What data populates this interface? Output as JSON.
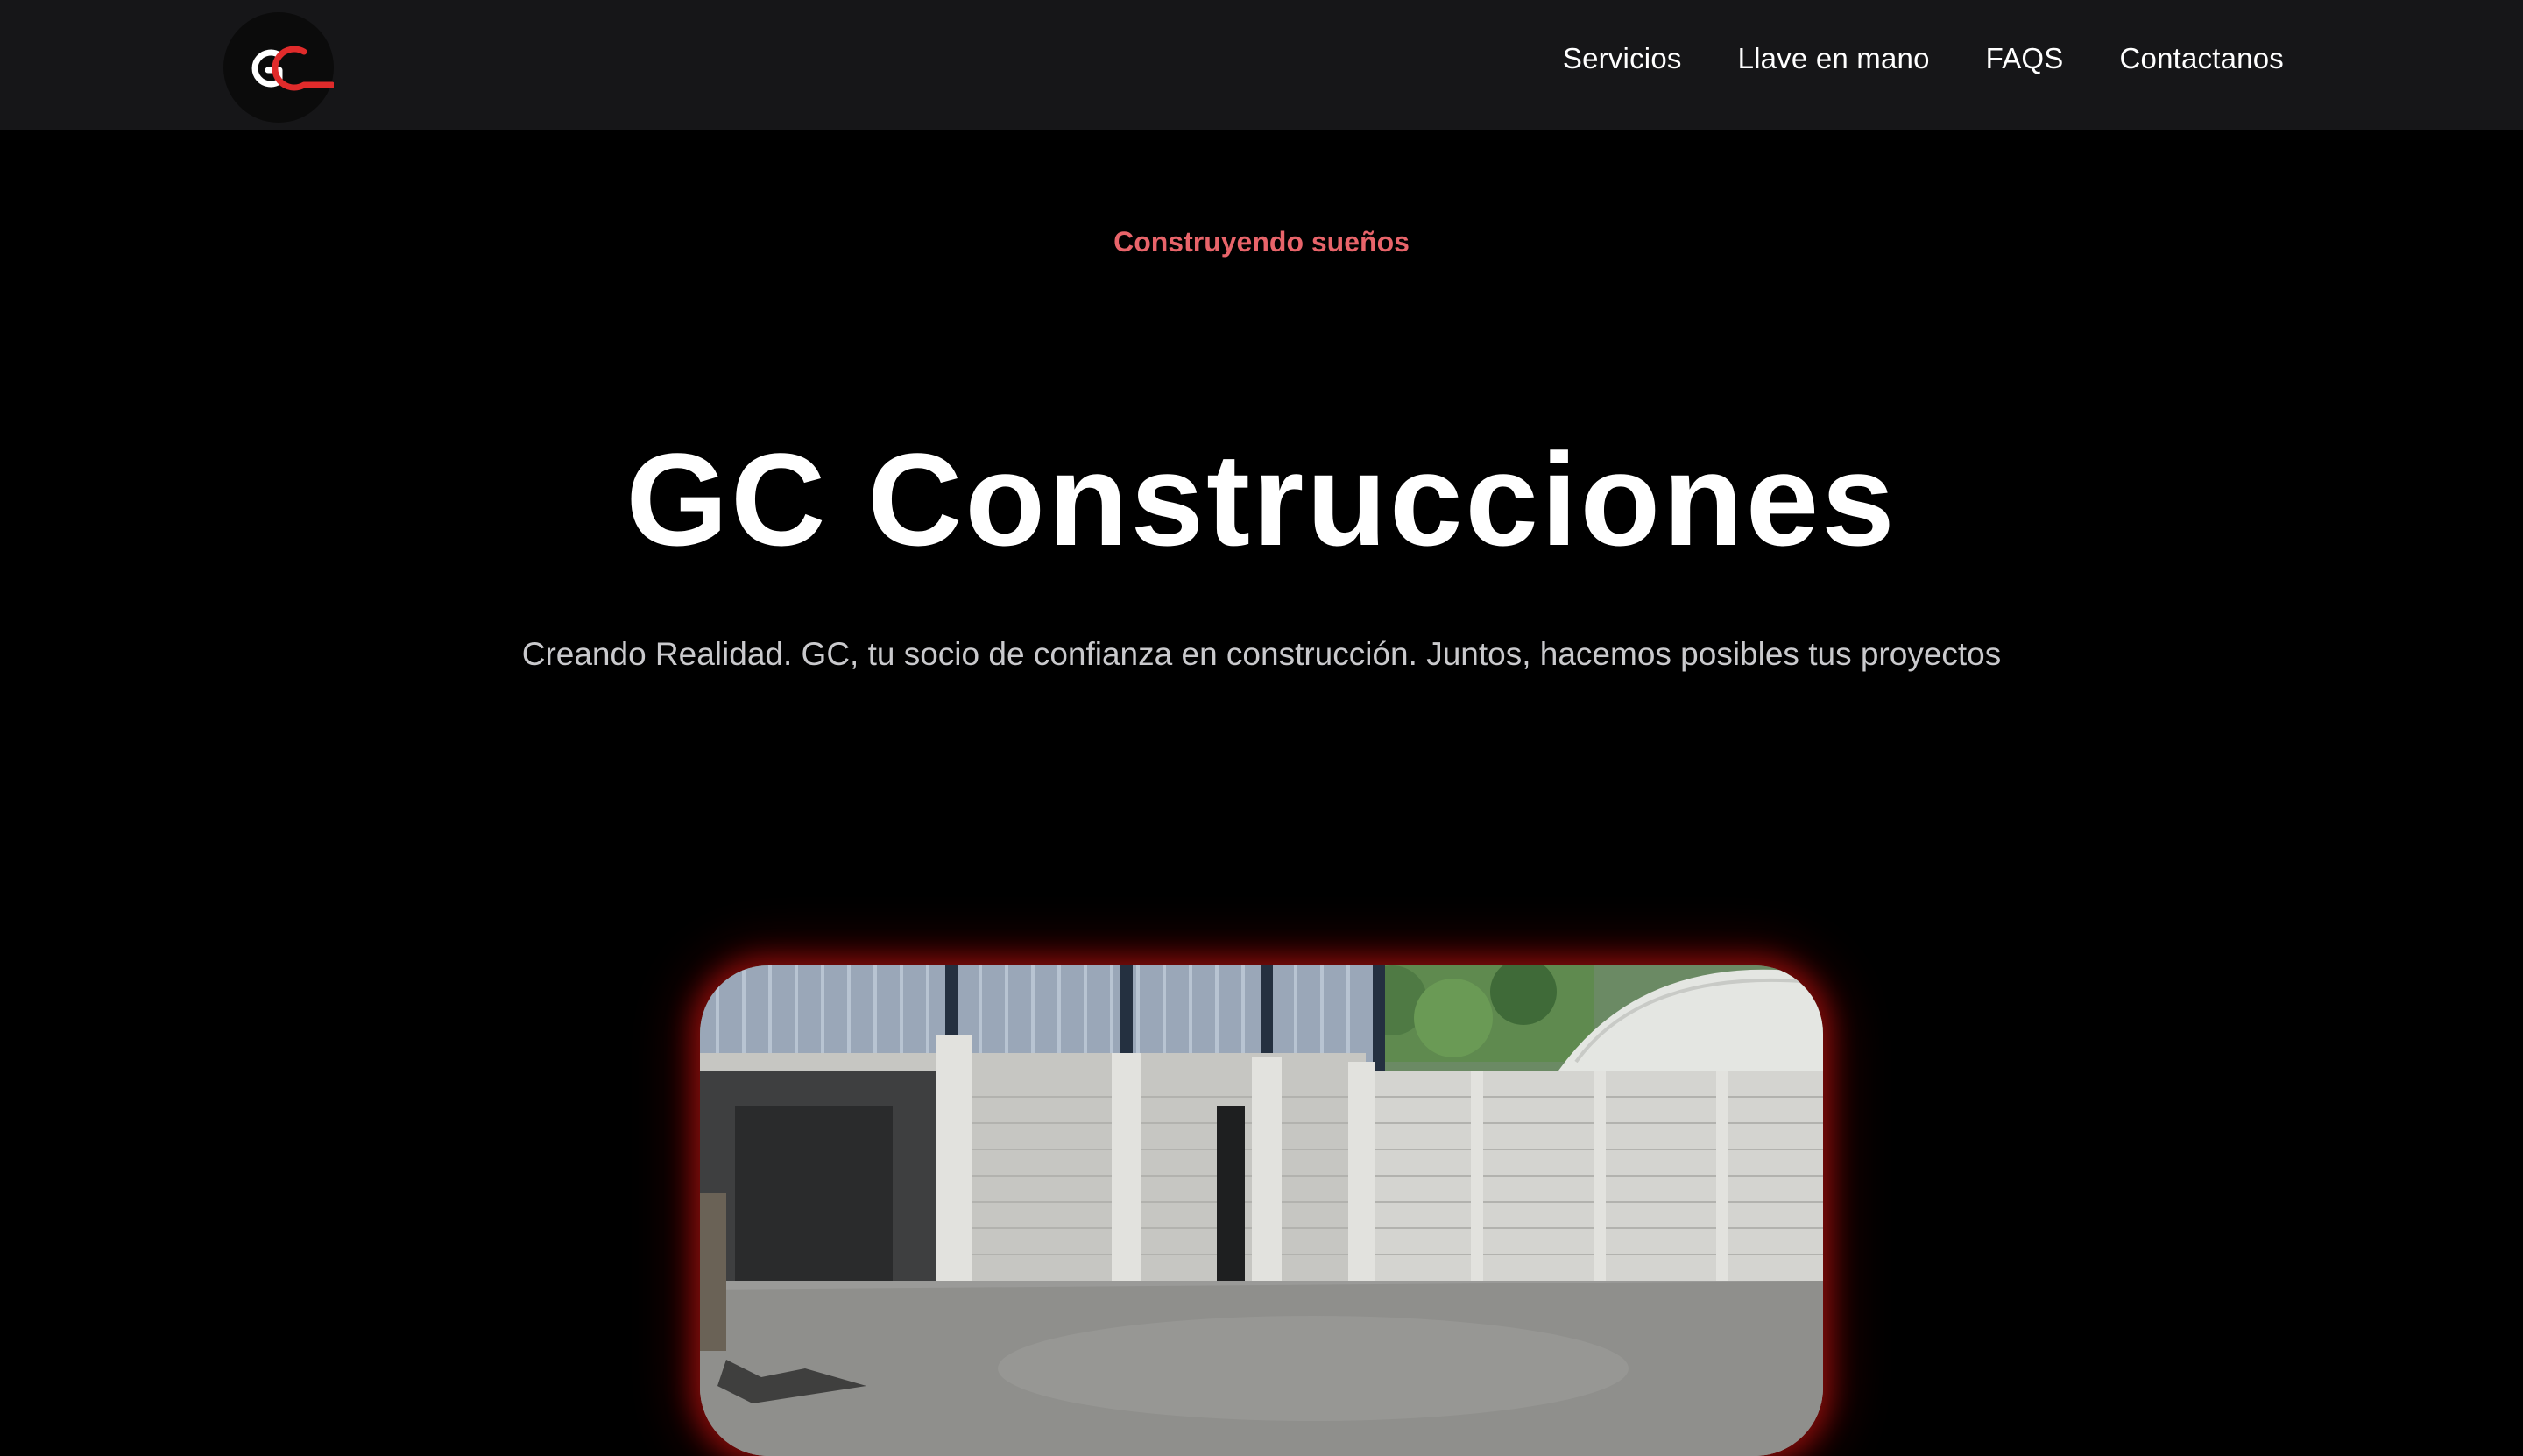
{
  "header": {
    "logo_text": "GC",
    "logo_icon": "gc-logo-icon",
    "nav": [
      {
        "label": "Servicios"
      },
      {
        "label": "Llave en mano"
      },
      {
        "label": "FAQS"
      },
      {
        "label": "Contactanos"
      }
    ]
  },
  "hero": {
    "eyebrow": "Construyendo sueños",
    "title": "GC Construcciones",
    "subtitle": "Creando Realidad. GC, tu socio de confianza en construcción. Juntos, hacemos posibles tus proyectos"
  },
  "media": {
    "kind": "video-preview",
    "icon": "construction-site-video"
  },
  "colors": {
    "header_bg": "#161618",
    "page_bg": "#000000",
    "accent": "#e8646a",
    "logo_red": "#e02b2b",
    "glow": "#c81612"
  }
}
